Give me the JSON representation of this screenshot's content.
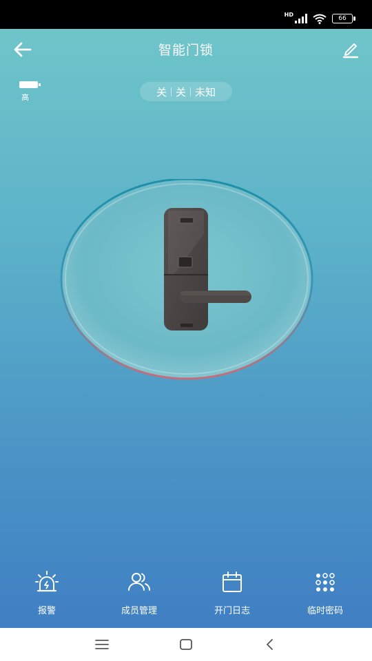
{
  "status_bar": {
    "hd": "HD",
    "battery": "66"
  },
  "header": {
    "title": "智能门锁"
  },
  "lock_battery": {
    "level_label": "高"
  },
  "state": {
    "values": [
      "关",
      "关",
      "未知"
    ]
  },
  "bottom_nav": [
    {
      "label": "报警",
      "icon": "alarm-icon"
    },
    {
      "label": "成员管理",
      "icon": "members-icon"
    },
    {
      "label": "开门日志",
      "icon": "calendar-icon"
    },
    {
      "label": "临时密码",
      "icon": "keypad-icon"
    }
  ],
  "system_nav": {
    "buttons": [
      "menu-icon",
      "home-icon",
      "back-icon"
    ]
  },
  "colors": {
    "gradient_top": "#6fc5c9",
    "gradient_bottom": "#3f7fc3",
    "lock_body": "#4a4645",
    "white": "#ffffff"
  }
}
